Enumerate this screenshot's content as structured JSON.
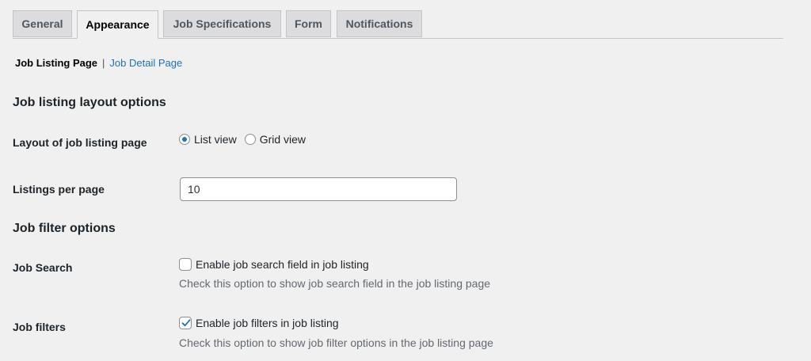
{
  "tabs": [
    {
      "label": "General",
      "active": false
    },
    {
      "label": "Appearance",
      "active": true
    },
    {
      "label": "Job Specifications",
      "active": false
    },
    {
      "label": "Form",
      "active": false
    },
    {
      "label": "Notifications",
      "active": false
    }
  ],
  "subnav": {
    "current": "Job Listing Page",
    "separator": "|",
    "link": "Job Detail Page"
  },
  "sections": {
    "layout_heading": "Job listing layout options",
    "filter_heading": "Job filter options"
  },
  "layout": {
    "label": "Layout of job listing page",
    "options": [
      {
        "label": "List view",
        "checked": true
      },
      {
        "label": "Grid view",
        "checked": false
      }
    ]
  },
  "listings": {
    "label": "Listings per page",
    "value": "10"
  },
  "job_search": {
    "label": "Job Search",
    "checkbox_label": "Enable job search field in job listing",
    "checked": false,
    "description": "Check this option to show job search field in the job listing page"
  },
  "job_filters": {
    "label": "Job filters",
    "checkbox_label": "Enable job filters in job listing",
    "checked": true,
    "description": "Check this option to show job filter options in the job listing page"
  },
  "colors": {
    "background": "#f0f0f1",
    "accent": "#2271b1",
    "tab_inactive": "#dcdcde"
  }
}
